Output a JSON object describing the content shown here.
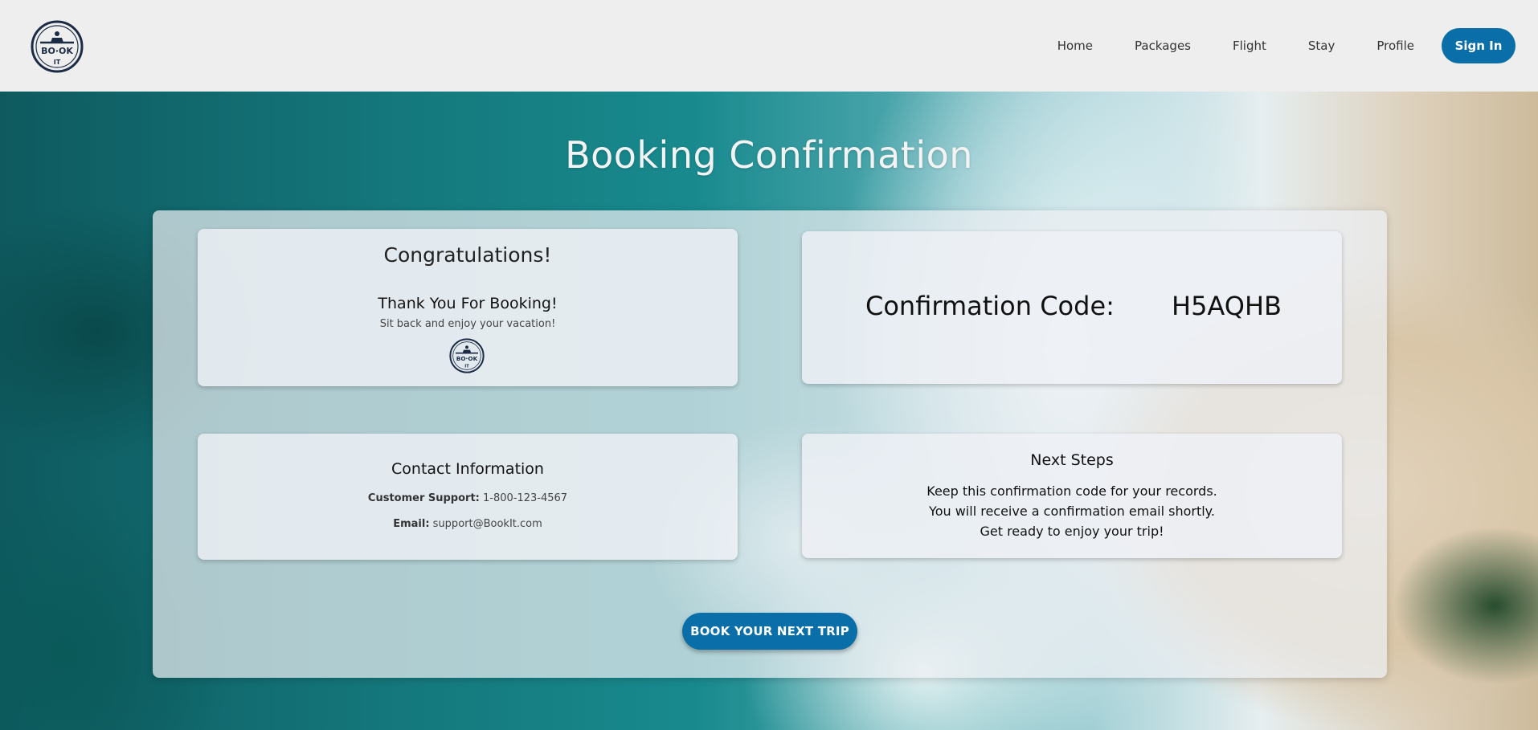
{
  "header": {
    "logo_icon": "bookit-compass-logo-icon",
    "nav": [
      "Home",
      "Packages",
      "Flight",
      "Stay",
      "Profile"
    ],
    "signin_label": "Sign In"
  },
  "page": {
    "title": "Booking Confirmation"
  },
  "congrats": {
    "title": "Congratulations!",
    "thanks": "Thank You For Booking!",
    "subtitle": "Sit back and enjoy your vacation!"
  },
  "confirmation": {
    "label": "Confirmation Code:",
    "code": "H5AQHB"
  },
  "contact": {
    "title": "Contact Information",
    "support_label": "Customer Support:",
    "support_value": "1-800-123-4567",
    "email_label": "Email:",
    "email_value": "support@BookIt.com"
  },
  "next_steps": {
    "title": "Next Steps",
    "lines": [
      "Keep this confirmation code for your records.",
      "You will receive a confirmation email shortly.",
      "Get ready to enjoy your trip!"
    ]
  },
  "cta_label": "BOOK YOUR NEXT TRIP",
  "colors": {
    "brand_blue": "#0a6fa8",
    "logo_navy": "#1c2b45"
  }
}
